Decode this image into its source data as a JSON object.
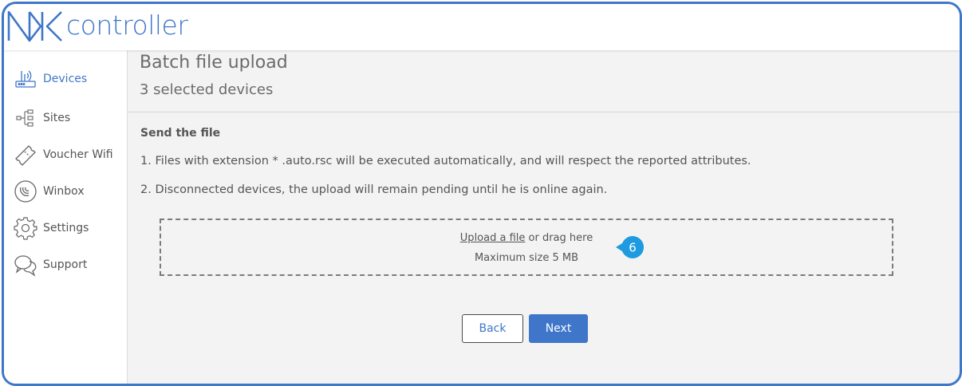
{
  "brand": {
    "logo_text": "controller",
    "accent_color": "#3f76c9"
  },
  "sidebar": {
    "items": [
      {
        "label": "Devices",
        "icon": "router-icon",
        "active": true
      },
      {
        "label": "Sites",
        "icon": "sites-tree-icon",
        "active": false
      },
      {
        "label": "Voucher Wifi",
        "icon": "ticket-icon",
        "active": false
      },
      {
        "label": "Winbox",
        "icon": "winbox-icon",
        "active": false
      },
      {
        "label": "Settings",
        "icon": "gear-icon",
        "active": false
      },
      {
        "label": "Support",
        "icon": "chat-bubbles-icon",
        "active": false
      }
    ]
  },
  "main": {
    "title": "Batch file upload",
    "subtitle": "3 selected devices",
    "section_title": "Send the file",
    "notes": [
      "1. Files with extension * .auto.rsc will be executed automatically, and will respect the reported attributes.",
      "2. Disconnected devices, the upload will remain pending until he is online again."
    ],
    "dropzone": {
      "upload_link": "Upload a file",
      "drag_text": " or drag here",
      "max_size": "Maximum size 5 MB"
    },
    "step_badge": "6",
    "buttons": {
      "back": "Back",
      "next": "Next"
    }
  }
}
